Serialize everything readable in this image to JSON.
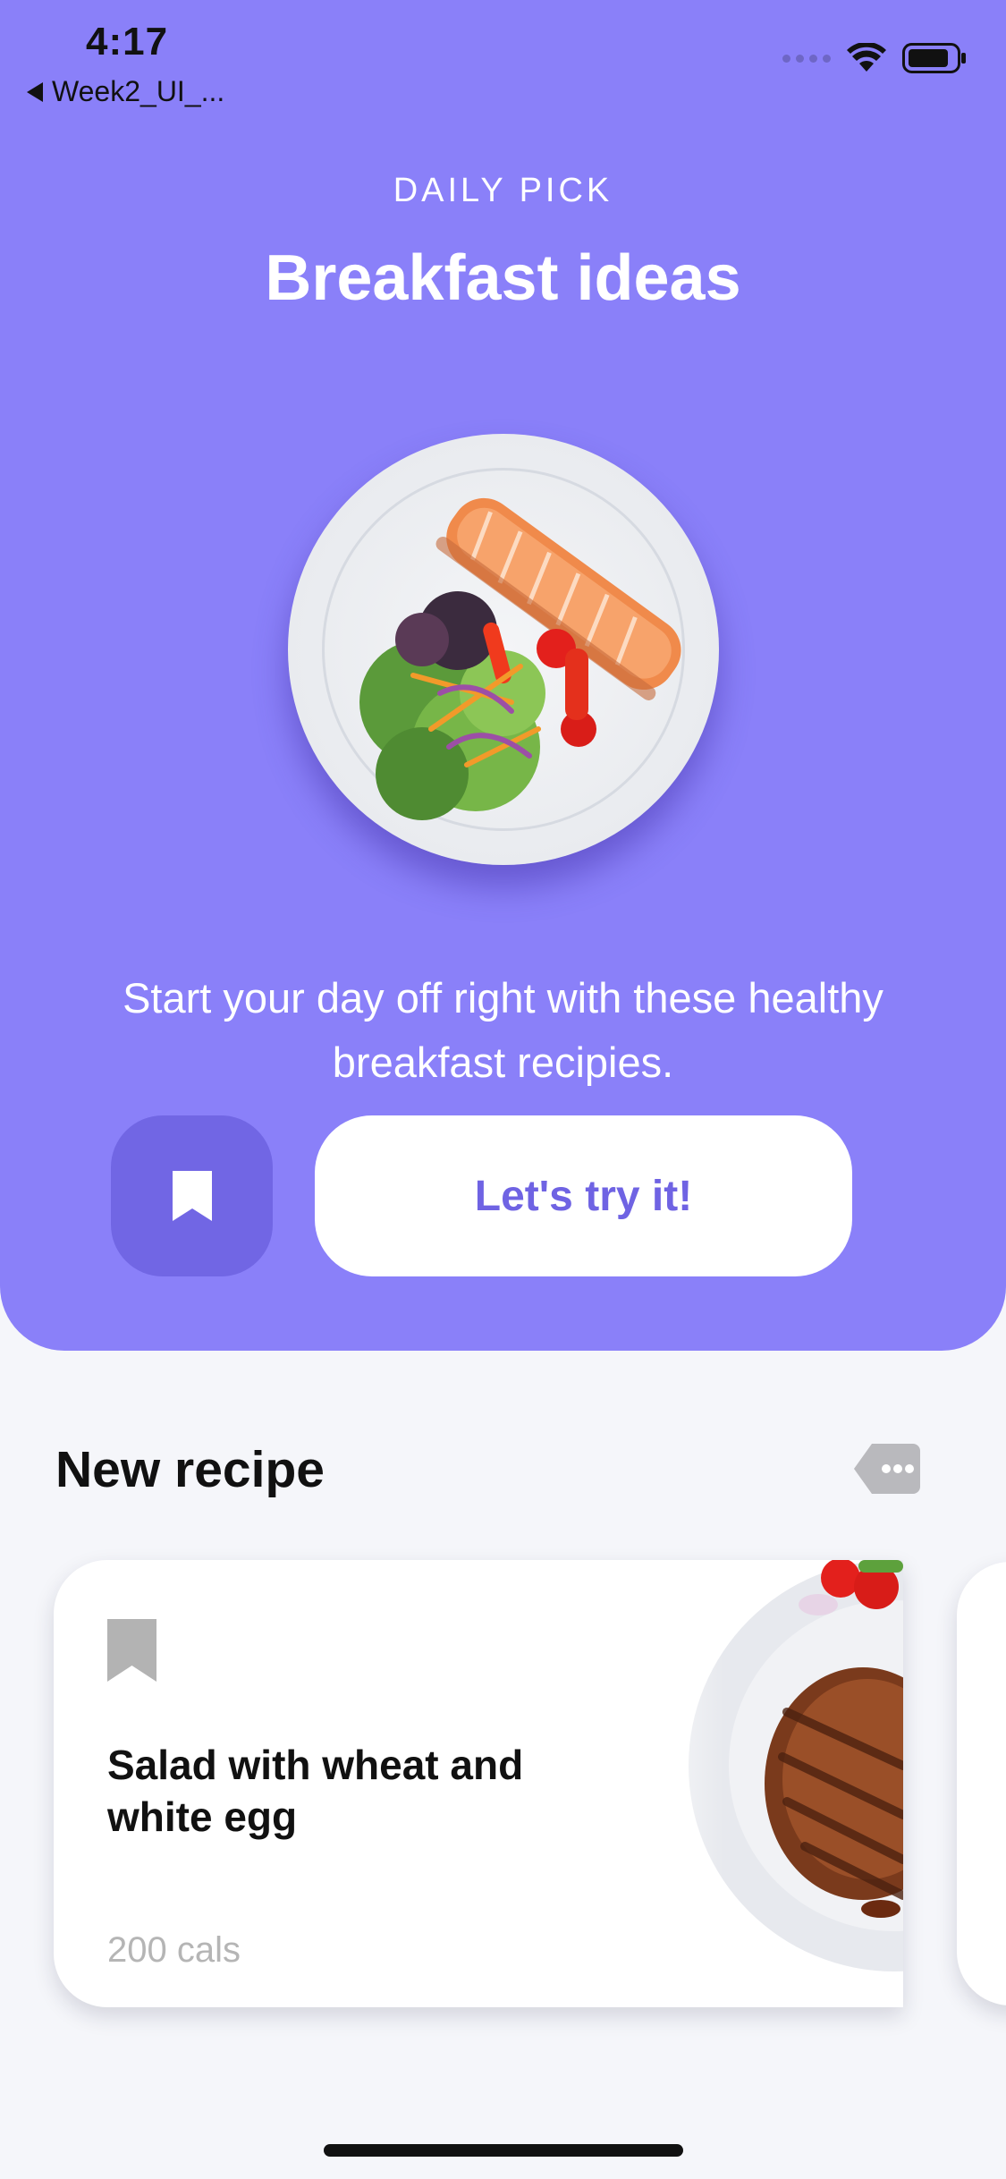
{
  "status_bar": {
    "time": "4:17",
    "back_app_label": "Week2_UI_..."
  },
  "hero": {
    "kicker": "DAILY PICK",
    "title": "Breakfast ideas",
    "image_icon": "salmon-salad-plate-image",
    "description": "Start your day off right with these healthy breakfast recipies.",
    "cta_label": "Let's try it!",
    "bookmark_icon": "bookmark-icon",
    "colors": {
      "background": "#8a80f9",
      "bookmark_button": "#7166e4",
      "cta_text": "#6f63e3"
    }
  },
  "new_recipe": {
    "title": "New recipe",
    "tag_icon": "tag-more-icon",
    "cards": [
      {
        "title": "Salad with wheat and white egg",
        "calories": "200 cals",
        "image_icon": "grilled-steak-plate-image"
      }
    ]
  }
}
